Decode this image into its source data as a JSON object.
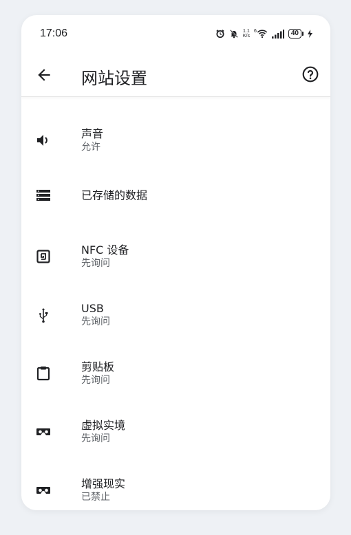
{
  "status_bar": {
    "time": "17:06",
    "net_speed_value": "1.1",
    "net_speed_unit": "K/s",
    "wifi_badge": "6",
    "battery_level": "40",
    "icons": [
      "alarm-icon",
      "notifications-off-icon",
      "wifi-icon",
      "signal-icon",
      "battery-icon",
      "charging-icon"
    ]
  },
  "app_bar": {
    "title": "网站设置",
    "back_icon": "arrow-back-icon",
    "help_icon": "help-circle-icon"
  },
  "settings": [
    {
      "icon": "volume-icon",
      "title": "声音",
      "subtitle": "允许"
    },
    {
      "icon": "storage-icon",
      "title": "已存储的数据",
      "subtitle": ""
    },
    {
      "icon": "nfc-icon",
      "title": "NFC 设备",
      "subtitle": "先询问"
    },
    {
      "icon": "usb-icon",
      "title": "USB",
      "subtitle": "先询问"
    },
    {
      "icon": "clipboard-icon",
      "title": "剪贴板",
      "subtitle": "先询问"
    },
    {
      "icon": "vr-headset-icon",
      "title": "虚拟实境",
      "subtitle": "先询问"
    },
    {
      "icon": "ar-headset-icon",
      "title": "增强现实",
      "subtitle": "已禁止"
    }
  ],
  "colors": {
    "text_primary": "#202124",
    "text_secondary": "#5f6368",
    "background": "#ffffff",
    "page_background": "#eef1f5"
  }
}
